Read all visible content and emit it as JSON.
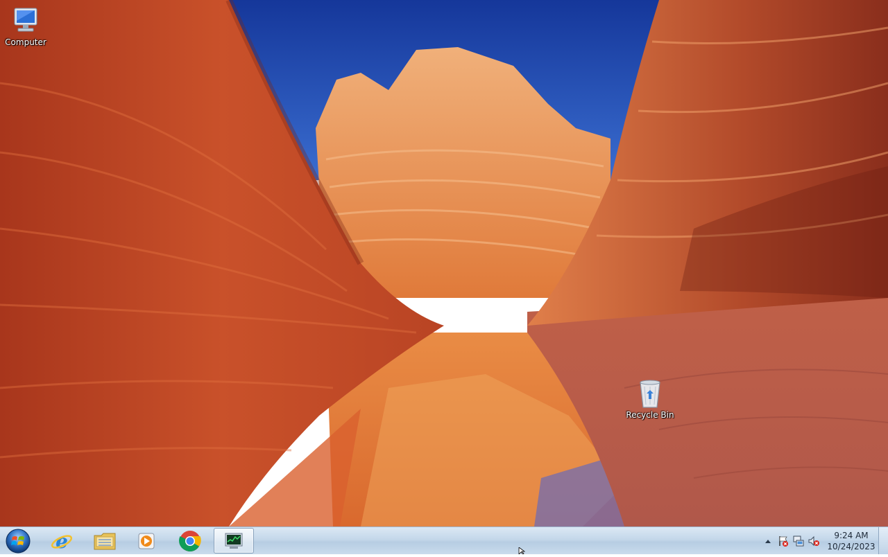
{
  "desktop": {
    "icons": [
      {
        "label": "Computer",
        "icon": "computer-icon"
      },
      {
        "label": "Recycle Bin",
        "icon": "recycle-bin-icon"
      }
    ],
    "wallpaper": "red sandstone canyon with blue sky reflected in water"
  },
  "taskbar": {
    "start_icon": "windows-start-orb-icon",
    "pinned": [
      {
        "icon": "internet-explorer-icon",
        "active": false
      },
      {
        "icon": "file-explorer-icon",
        "active": false
      },
      {
        "icon": "media-player-icon",
        "active": false
      },
      {
        "icon": "chrome-icon",
        "active": false
      },
      {
        "icon": "task-manager-icon",
        "active": true
      }
    ],
    "tray": {
      "icons": [
        "show-hidden-icons-arrow-icon",
        "action-center-flag-icon",
        "network-icon",
        "volume-muted-icon"
      ],
      "clock": {
        "time": "9:24 AM",
        "date": "10/24/2023"
      }
    }
  },
  "colors": {
    "taskbar_top": "#dbe8f4",
    "taskbar_bottom": "#c9dbec",
    "sky": "#1f4aa8",
    "rock": "#c8502a"
  }
}
